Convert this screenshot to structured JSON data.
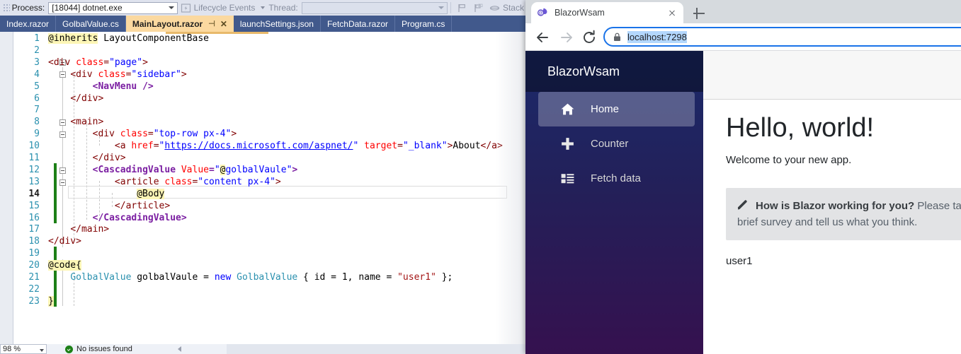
{
  "vs": {
    "toolbar": {
      "process_label": "Process:",
      "process_value": "[18044] dotnet.exe",
      "lifecycle_label": "Lifecycle Events",
      "thread_label": "Thread:",
      "thread_value": "",
      "stack_label": "Stack",
      "icons": [
        "lifecycle-events-icon",
        "breakpoint-flag-icon",
        "step-icon",
        "stack-frame-icon"
      ]
    },
    "tabs": [
      {
        "label": "Index.razor",
        "active": false
      },
      {
        "label": "GolbalValue.cs",
        "active": false
      },
      {
        "label": "MainLayout.razor",
        "active": true
      },
      {
        "label": "launchSettings.json",
        "active": false
      },
      {
        "label": "FetchData.razor",
        "active": false
      },
      {
        "label": "Program.cs",
        "active": false
      }
    ],
    "active_tab_pin": "⊣",
    "active_tab_close": "✕",
    "code": [
      {
        "n": 1,
        "html": "<span class='s-razor'>@inherits</span> <span class='s-plain'>LayoutComponentBase</span>"
      },
      {
        "n": 2,
        "html": ""
      },
      {
        "n": 3,
        "html": "<span class='s-tag'>&lt;div</span> <span class='s-attr'>class</span><span class='s-tag'>=</span><span class='s-str'>\"page\"</span><span class='s-tag'>&gt;</span>"
      },
      {
        "n": 4,
        "html": "    <span class='s-tag'>&lt;div</span> <span class='s-attr'>class</span><span class='s-tag'>=</span><span class='s-str'>\"sidebar\"</span><span class='s-tag'>&gt;</span>"
      },
      {
        "n": 5,
        "html": "        <span class='s-comp'>&lt;NavMenu /&gt;</span>"
      },
      {
        "n": 6,
        "html": "    <span class='s-tag'>&lt;/div&gt;</span>"
      },
      {
        "n": 7,
        "html": ""
      },
      {
        "n": 8,
        "html": "    <span class='s-tag'>&lt;main&gt;</span>"
      },
      {
        "n": 9,
        "html": "        <span class='s-tag'>&lt;div</span> <span class='s-attr'>class</span><span class='s-tag'>=</span><span class='s-str'>\"top-row px-4\"</span><span class='s-tag'>&gt;</span>"
      },
      {
        "n": 10,
        "html": "            <span class='s-tag'>&lt;a</span> <span class='s-attr'>href</span><span class='s-tag'>=</span><span class='s-str'>\"</span><span class='s-link'>https://docs.microsoft.com/aspnet/</span><span class='s-str'>\"</span> <span class='s-attr'>target</span><span class='s-tag'>=</span><span class='s-str'>\"_blank\"</span><span class='s-tag'>&gt;</span><span class='s-plain'>About</span><span class='s-tag'>&lt;/a&gt;</span>"
      },
      {
        "n": 11,
        "html": "        <span class='s-tag'>&lt;/div&gt;</span>"
      },
      {
        "n": 12,
        "html": "        <span class='s-comp'>&lt;CascadingValue</span> <span class='s-attr'>Value</span><span class='s-comp'>=</span><span class='s-str'>\"</span><span class='s-razor'>@</span><span class='s-str'>golbalVaule\"</span><span class='s-comp'>&gt;</span>"
      },
      {
        "n": 13,
        "html": "            <span class='s-tag'>&lt;article</span> <span class='s-attr'>class</span><span class='s-tag'>=</span><span class='s-str'>\"content px-4\"</span><span class='s-tag'>&gt;</span>"
      },
      {
        "n": 14,
        "html": "                <span class='s-razor'>@Body</span>"
      },
      {
        "n": 15,
        "html": "            <span class='s-tag'>&lt;/article&gt;</span>"
      },
      {
        "n": 16,
        "html": "        <span class='s-comp'>&lt;/CascadingValue&gt;</span>"
      },
      {
        "n": 17,
        "html": "    <span class='s-tag'>&lt;/main&gt;</span>"
      },
      {
        "n": 18,
        "html": "<span class='s-tag'>&lt;/div&gt;</span>"
      },
      {
        "n": 19,
        "html": ""
      },
      {
        "n": 20,
        "html": "<span class='s-razor'>@code{</span>"
      },
      {
        "n": 21,
        "html": "    <span class='s-type'>GolbalValue</span> <span class='s-plain'>golbalVaule</span> <span class='s-plain'>=</span> <span class='s-kw'>new</span> <span class='s-type'>GolbalValue</span> <span class='s-plain'>{ id = 1, name = </span><span class='s-strcs'>\"user1\"</span><span class='s-plain'> };</span>"
      },
      {
        "n": 22,
        "html": ""
      },
      {
        "n": 23,
        "html": "<span class='s-razor'>}</span>"
      }
    ],
    "current_line": 14,
    "status": {
      "zoom": "98 %",
      "issues": "No issues found"
    }
  },
  "browser": {
    "tab": {
      "title": "BlazorWsam",
      "favicon": "blazor-logo-icon",
      "close": "close-icon"
    },
    "new_tab": "+",
    "nav": {
      "back": "back-arrow-icon",
      "forward": "forward-arrow-icon",
      "reload": "reload-icon"
    },
    "omnibox": {
      "lock": "lock-icon",
      "url": "localhost:7298"
    }
  },
  "app": {
    "brand": "BlazorWsam",
    "nav_items": [
      {
        "label": "Home",
        "icon": "home-icon",
        "active": true
      },
      {
        "label": "Counter",
        "icon": "plus-icon",
        "active": false
      },
      {
        "label": "Fetch data",
        "icon": "list-icon",
        "active": false
      }
    ],
    "heading": "Hello, world!",
    "lead": "Welcome to your new app.",
    "survey": {
      "icon": "pencil-icon",
      "strong": "How is Blazor working for you?",
      "rest": " Please take our brief survey and tell us what you think."
    },
    "user_value": "user1"
  },
  "colors": {
    "vs_tab_active": "#fbd9a0",
    "vs_tabstrip": "#41598c",
    "chrome_omnibox_focus": "#1a73e8",
    "app_sidebar_top": "#1b2a6b",
    "app_sidebar_bottom": "#35114f",
    "survey_bg": "#e2e3e5",
    "ok_green": "#1d8017"
  }
}
